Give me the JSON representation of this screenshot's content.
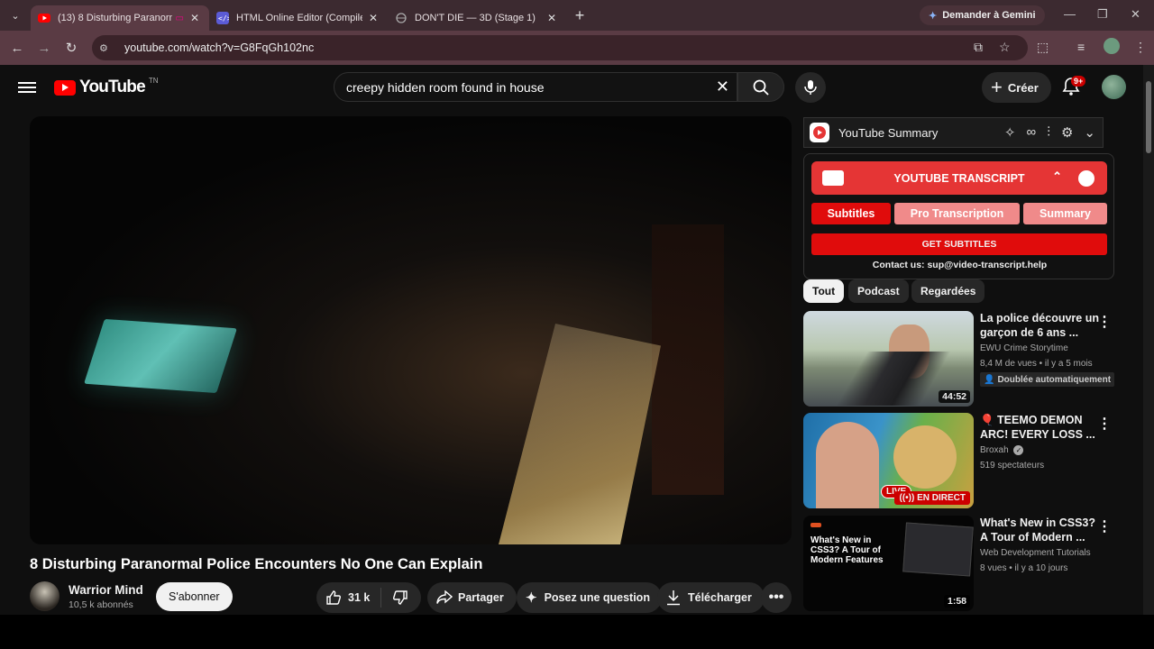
{
  "browser": {
    "tabs": [
      {
        "title": "(13) 8 Disturbing Paranorm",
        "favicon": "youtube-icon",
        "active": true
      },
      {
        "title": "HTML Online Editor (Compiler,",
        "favicon": "code-editor-icon",
        "active": false
      },
      {
        "title": "DON'T DIE — 3D (Stage 1)",
        "favicon": "globe-icon",
        "active": false
      }
    ],
    "gemini_label": "Demander à Gemini",
    "url": "youtube.com/watch?v=G8FqGh102nc"
  },
  "header": {
    "logo_text": "YouTube",
    "country_code": "TN",
    "search_query": "creepy hidden room found in house",
    "create_label": "Créer",
    "notification_count": "9+"
  },
  "video": {
    "title": "8 Disturbing Paranormal Police Encounters No One Can Explain",
    "channel_name": "Warrior Mind",
    "subscribers": "10,5 k abonnés",
    "subscribe_label": "S'abonner",
    "likes": "31 k",
    "share_label": "Partager",
    "ask_label": "Posez une question",
    "download_label": "Télécharger"
  },
  "extension": {
    "summary_title": "YouTube Summary",
    "transcript_title": "YOUTUBE TRANSCRIPT",
    "tab_subtitles": "Subtitles",
    "tab_pro": "Pro Transcription",
    "tab_summary": "Summary",
    "get_subtitles": "GET SUBTITLES",
    "contact": "Contact us: sup@video-transcript.help",
    "accent_color": "#e53535"
  },
  "chips": [
    "Tout",
    "Podcast",
    "Regardées"
  ],
  "recommendations": [
    {
      "title": "La police découvre un garçon de 6 ans ...",
      "channel": "EWU Crime Storytime",
      "stats": "8,4 M de vues • il y a 5 mois",
      "badge": "Doublée automatiquement",
      "duration": "44:52"
    },
    {
      "title": "🎈 TEEMO DEMON ARC! EVERY LOSS ...",
      "channel": "Broxah",
      "stats": "519 spectateurs",
      "thumb_live": "LIVE",
      "live_badge": "EN DIRECT"
    },
    {
      "title": "What's New in CSS3? A Tour of Modern ...",
      "channel": "Web Development Tutorials",
      "stats": "8 vues • il y a 10 jours",
      "thumb_text": "What's New in CSS3? A Tour of Modern Features",
      "duration": "1:58"
    }
  ]
}
